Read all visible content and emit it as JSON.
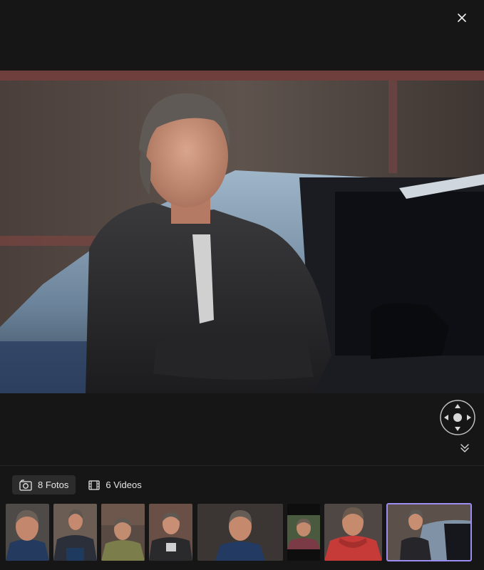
{
  "viewer": {
    "close_icon": "close-icon",
    "pan_icon": "pan-control-icon",
    "collapse_icon": "chevron-double-down-icon"
  },
  "tabs": [
    {
      "label": "8 Fotos",
      "icon": "camera-icon",
      "active": true
    },
    {
      "label": "6 Videos",
      "icon": "film-icon",
      "active": false
    }
  ],
  "thumbnails": {
    "count": 8,
    "selected_index": 7
  },
  "colors": {
    "background": "#161616",
    "tab_active_bg": "#2c2c2c",
    "selection_outline": "#9b8cf0"
  }
}
